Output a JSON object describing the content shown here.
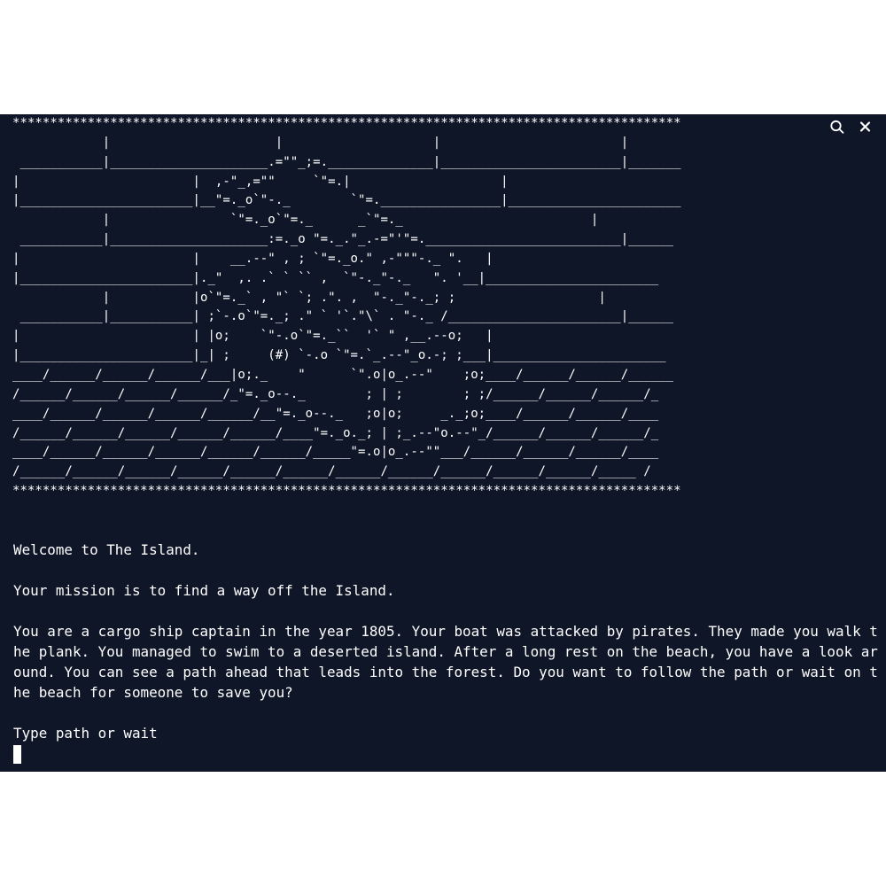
{
  "terminal": {
    "background": "#0f1628",
    "foreground": "#ffffff",
    "controls": [
      "search-icon",
      "close-icon"
    ]
  },
  "ascii_art": [
    "*****************************************************************************************",
    "            |                      |                    |                        |      ",
    " ___________|_____________________.=\"\"_;=.______________|________________________|_______",
    "|                       |  ,-\"_,=\"\"     `\"=.|                    |                       ",
    "|_______________________|__\"=._o`\"-._        `\"=.________________|_______________________",
    "            |                `\"=._o`\"=._      _`\"=._                         |          ",
    " ___________|_____________________:=._o \"=._.\"_.-=\"'\"=.__________________________|______",
    "|                       |    __.--\" , ; `\"=._o.\" ,-\"\"\"-._ \".   |                       ",
    "|_______________________|._\"  ,. .` ` `` ,  `\"-._\"-._   \". '__|_______________________",
    "            |           |o`\"=._` , \"` `; .\". ,  \"-._\"-._; ;                   |          ",
    " ___________|___________| ;`-.o`\"=._; .\" ` '`.\"\\` . \"-._ /_______________________|______",
    "|                       | |o;    `\"-.o`\"=._``  '` \" ,__.--o;   |                       ",
    "|_______________________|_| ;     (#) `-.o `\"=.`_.--\"_o.-; ;___|_______________________",
    "____/______/______/______/___|o;._    \"      `\".o|o_.--\"    ;o;____/______/______/______",
    "/______/______/______/______/_\"=._o--._        ; | ;        ; ;/______/______/______/_",
    "____/______/______/______/______/__\"=._o--._   ;o|o;     _._;o;____/______/______/____",
    "/______/______/______/______/______/____\"=._o._; | ;_.--\"o.--\"_/______/______/______/_",
    "____/______/______/______/______/______/_____\"=.o|o_.--\"\"___/______/______/______/____",
    "/______/______/______/______/______/______/______/______/______/______/______/_____ /",
    "*****************************************************************************************"
  ],
  "story": {
    "welcome": "Welcome to The Island.",
    "mission": "Your mission is to find a way off the Island.",
    "intro": "You are a cargo ship captain in the year 1805. Your boat was attacked by pirates. They made you walk the plank. You managed to swim to a deserted island. After a long rest on the beach, you have a look around. You can see a path ahead that leads into the forest. Do you want to follow the path or wait on the beach for someone to save you?",
    "prompt": "Type path or wait"
  }
}
